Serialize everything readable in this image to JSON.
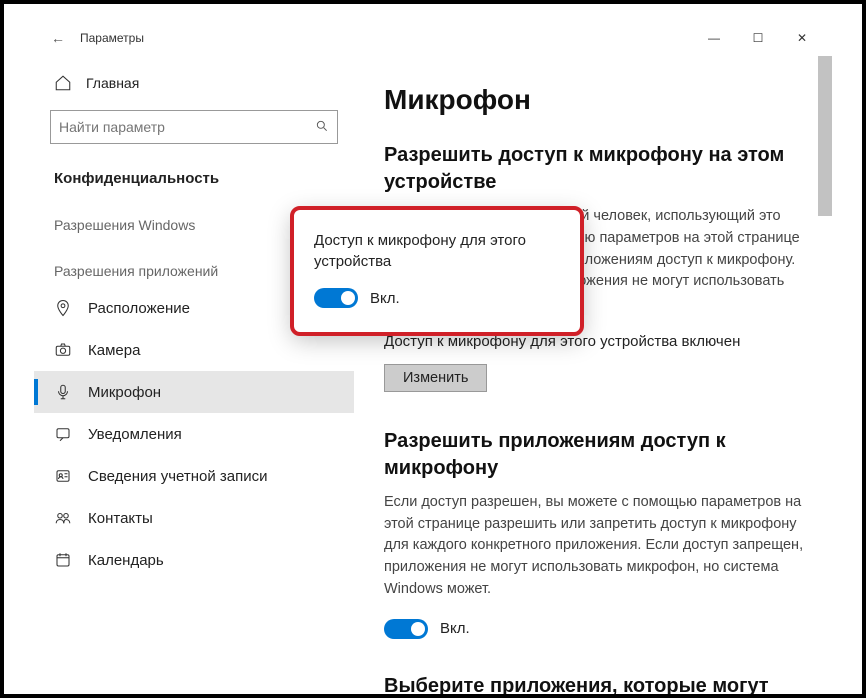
{
  "window": {
    "title": "Параметры"
  },
  "sidebar": {
    "home": "Главная",
    "search_placeholder": "Найти параметр",
    "section": "Конфиденциальность",
    "group1": "Разрешения Windows",
    "group2": "Разрешения приложений",
    "items": [
      {
        "label": "Расположение"
      },
      {
        "label": "Камера"
      },
      {
        "label": "Микрофон"
      },
      {
        "label": "Уведомления"
      },
      {
        "label": "Сведения учетной записи"
      },
      {
        "label": "Контакты"
      },
      {
        "label": "Календарь"
      }
    ]
  },
  "content": {
    "h1": "Микрофон",
    "sec1_title": "Разрешить доступ к микрофону на этом устройстве",
    "sec1_desc": "Если доступ разрешен, любой человек, использующий это устройство, сможет с помощью параметров на этой странице разрешить или запретить приложениям доступ к микрофону. Если доступ запрещен, приложения не могут использовать микрофон.",
    "sec1_status": "Доступ к микрофону для этого устройства включен",
    "change_btn": "Изменить",
    "sec2_title": "Разрешить приложениям доступ к микрофону",
    "sec2_desc": "Если доступ разрешен, вы можете с помощью параметров на этой странице разрешить или запретить доступ к микрофону для каждого конкретного приложения. Если доступ запрещен, приложения не могут использовать микрофон, но система Windows может.",
    "toggle_on": "Вкл.",
    "sec3_title_partial": "Выберите приложения, которые могут"
  },
  "flyout": {
    "title": "Доступ к микрофону для этого устройства",
    "toggle_label": "Вкл."
  }
}
